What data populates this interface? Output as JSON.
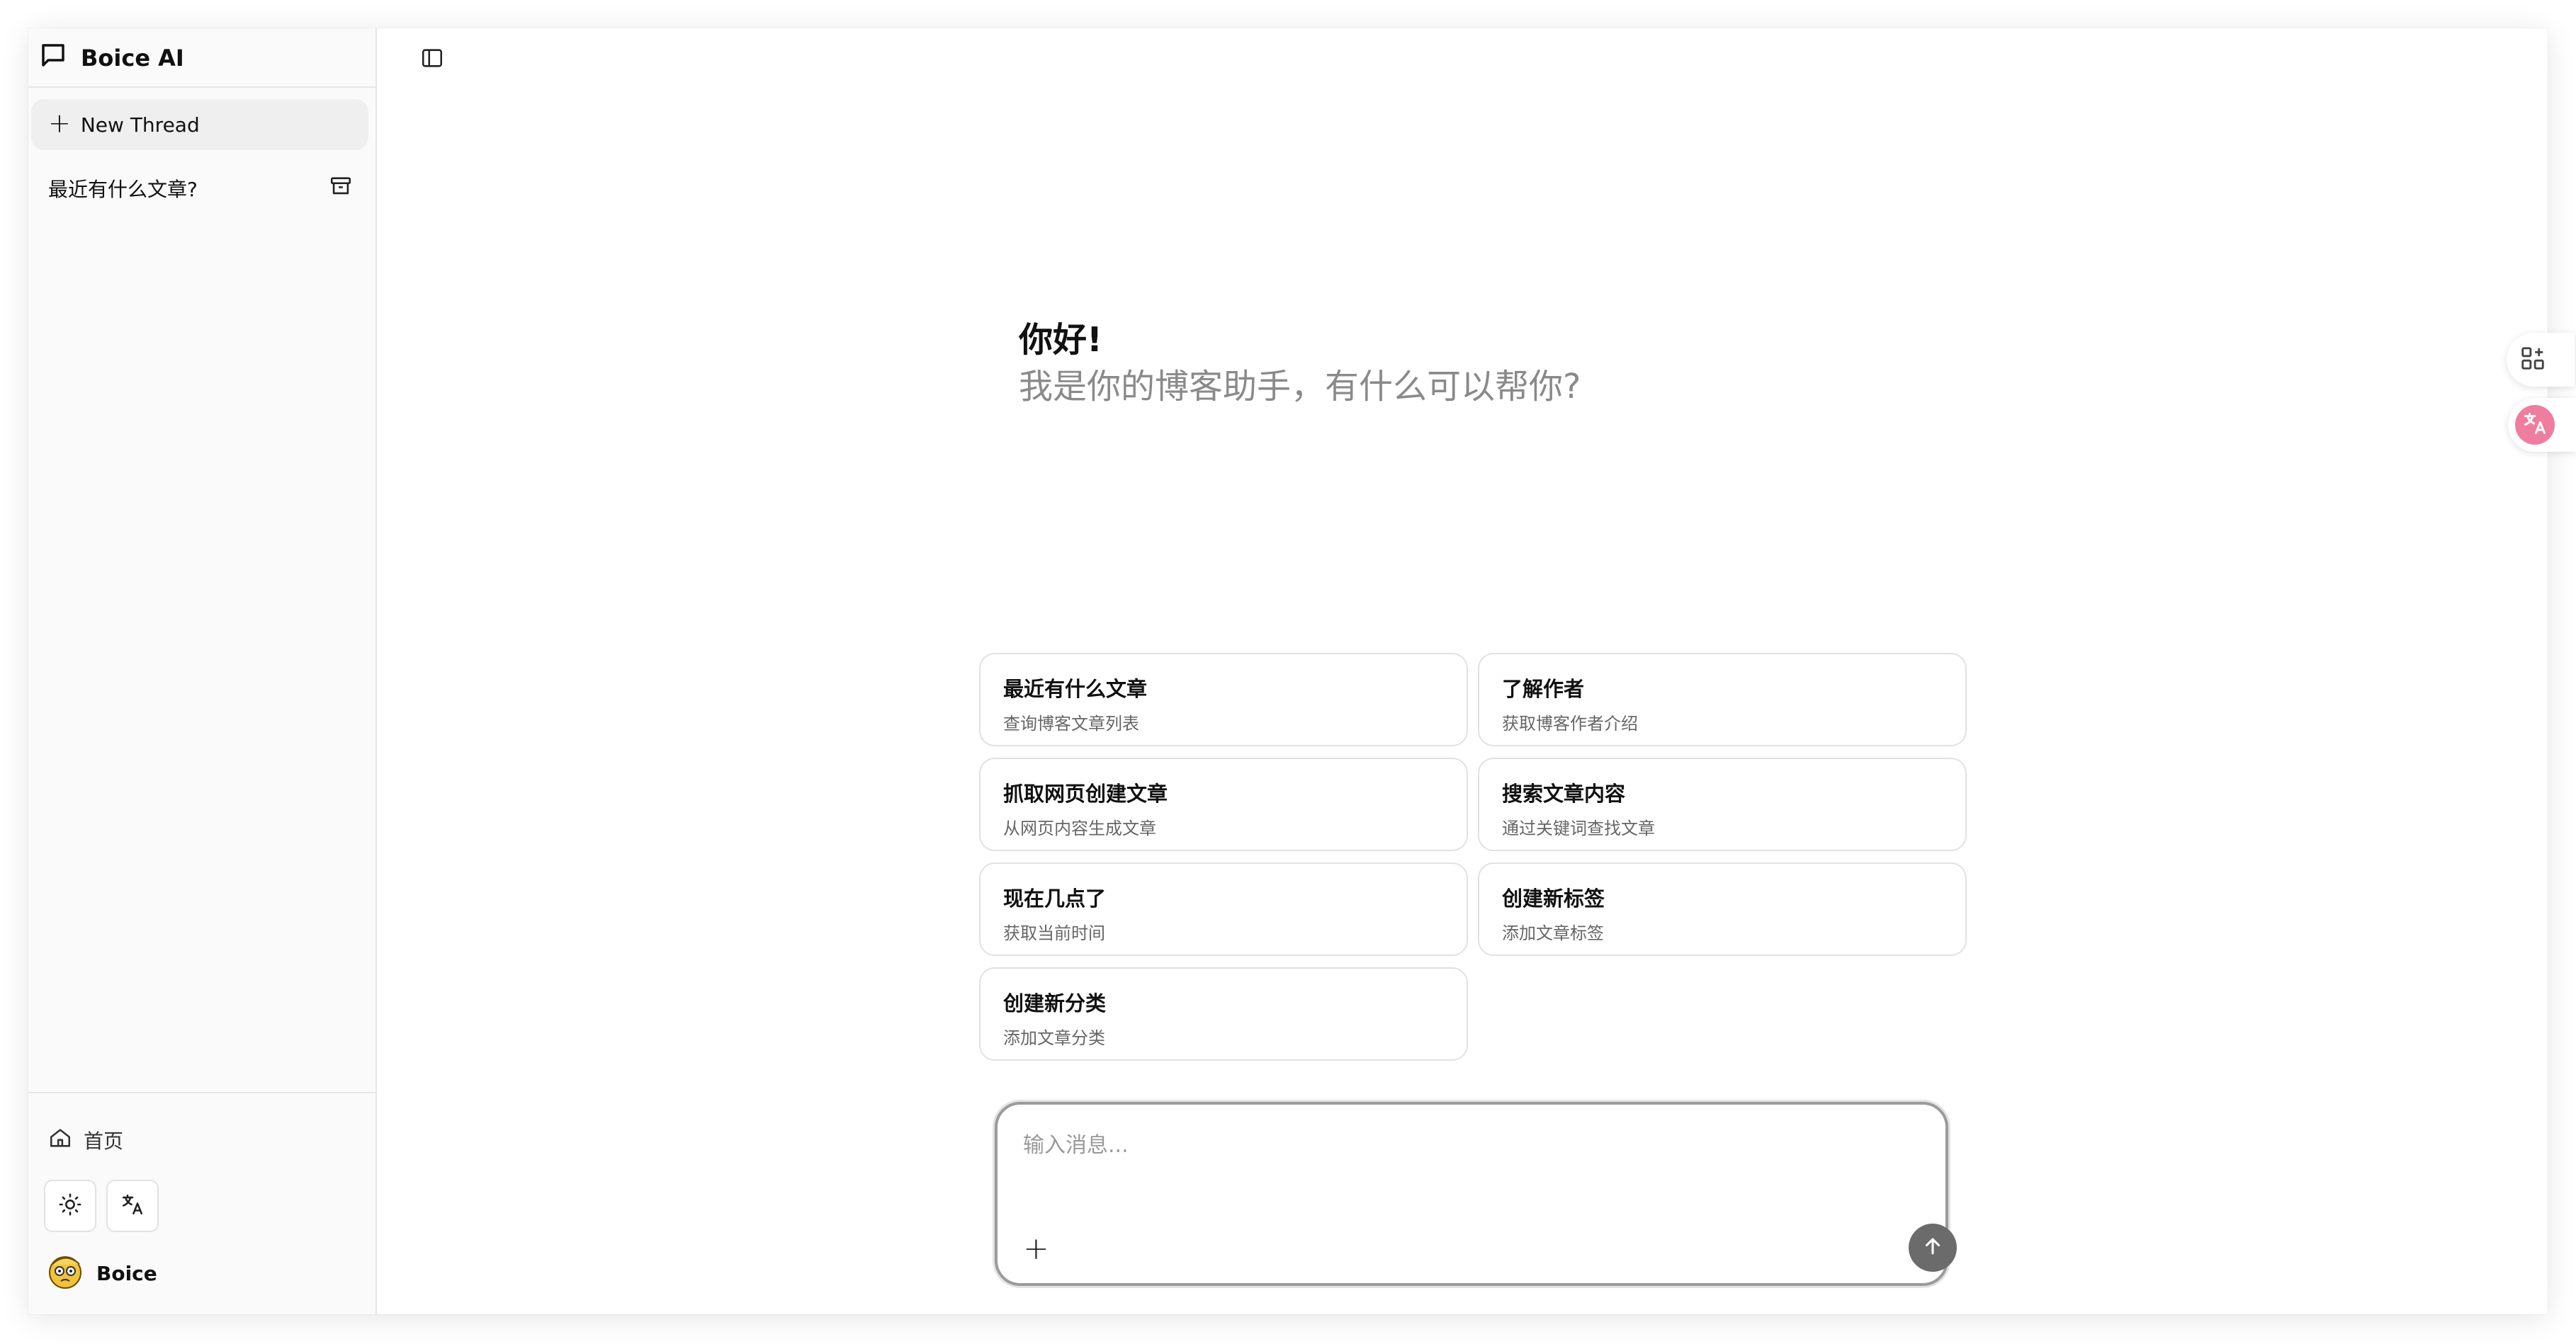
{
  "app": {
    "title": "Boice AI",
    "icon": "chat-bubble-icon"
  },
  "sidebar": {
    "new_thread_label": "New Thread",
    "threads": [
      {
        "title": "最近有什么文章?",
        "action_icon": "archive-icon"
      }
    ],
    "home_label": "首页",
    "theme_icon": "sun-icon",
    "language_icon": "translate-icon",
    "user_name": "Boice"
  },
  "main": {
    "greeting_title": "你好!",
    "greeting_subtitle": "我是你的博客助手，有什么可以帮你?",
    "suggestions": [
      {
        "title": "最近有什么文章",
        "desc": "查询博客文章列表"
      },
      {
        "title": "了解作者",
        "desc": "获取博客作者介绍"
      },
      {
        "title": "抓取网页创建文章",
        "desc": "从网页内容生成文章"
      },
      {
        "title": "搜索文章内容",
        "desc": "通过关键词查找文章"
      },
      {
        "title": "现在几点了",
        "desc": "获取当前时间"
      },
      {
        "title": "创建新标签",
        "desc": "添加文章标签"
      },
      {
        "title": "创建新分类",
        "desc": "添加文章分类"
      }
    ],
    "composer": {
      "placeholder": "输入消息...",
      "value": "",
      "attach_label": "+",
      "send_icon": "arrow-up-icon"
    }
  },
  "colors": {
    "sidebar_bg": "#fafafa",
    "accent_pink": "#ef7da0",
    "send_button": "#6b6b6b"
  }
}
